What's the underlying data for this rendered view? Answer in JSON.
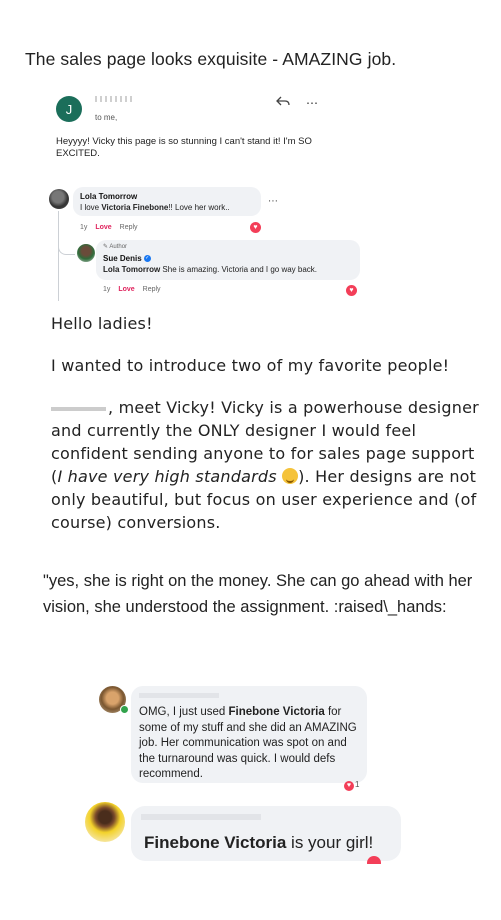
{
  "headline": "The sales page looks exquisite - AMAZING job.",
  "email": {
    "avatar_letter": "J",
    "to_label": "to me,",
    "body": "Heyyyy! Vicky this page is so stunning I can't stand it! I'm SO EXCITED."
  },
  "thread": {
    "comment1": {
      "name": "Lola Tomorrow",
      "text_before": "I love ",
      "text_bold": "Victoria Finebone",
      "text_after": "!! Love her work..",
      "time": "1y",
      "love": "Love",
      "reply": "Reply"
    },
    "reply1": {
      "author_tag": "Author",
      "name": "Sue Denis",
      "mention": "Lola Tomorrow",
      "text": " She is amazing. Victoria and I go way back.",
      "time": "1y",
      "love": "Love",
      "reply": "Reply"
    }
  },
  "intro": {
    "greeting": "Hello ladies!",
    "line2": "I wanted to introduce two of my favorite people!",
    "para_start": ", meet Vicky! Vicky is a powerhouse designer and currently the ONLY designer I would feel confident sending anyone to for sales page support (",
    "para_italic": "I have very high standards",
    "para_end": "). Her designs are not only beautiful, but focus on user experience and (of course) conversions."
  },
  "quote": "\"yes, she is right on the money. She can go ahead with her vision, she understood the assignment. :raised\\_hands:",
  "comment3": {
    "text_before": "OMG, I just used ",
    "text_bold": "Finebone Victoria",
    "text_after": " for some of my stuff and she did an AMAZING job. Her communication was spot on and the turnaround was quick. I would defs recommend.",
    "reaction_count": "1"
  },
  "comment4": {
    "text_bold": "Finebone Victoria",
    "text_after": " is your girl!"
  },
  "colors": {
    "love": "#e0245e",
    "heart": "#f33e58",
    "bubble": "#f0f2f5",
    "email_avatar": "#1b6e5a",
    "verified": "#1877f2"
  }
}
